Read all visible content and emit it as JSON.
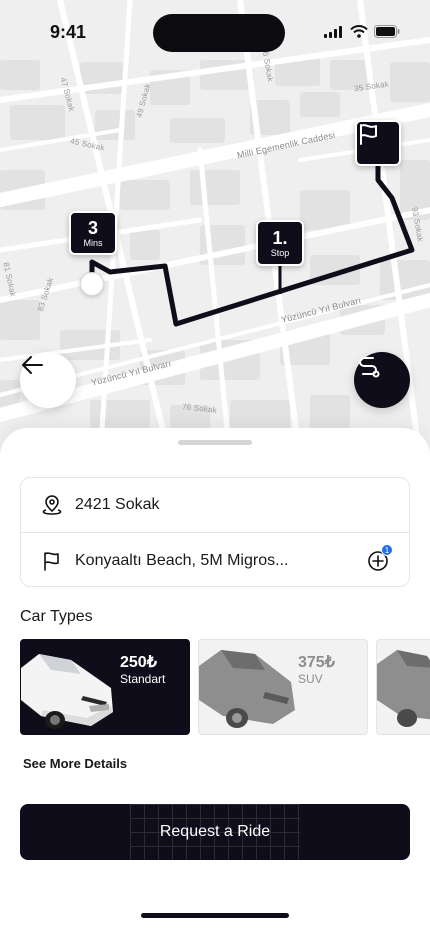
{
  "status_bar": {
    "time": "9:41"
  },
  "map": {
    "street_labels": [
      "Milli Egemenlik Caddesi",
      "Yüzüncü Yıl Bulvarı",
      "Yüzüncü Yıl Bulvarı",
      "76 Sokak",
      "49 Sokak",
      "47 Sokak",
      "45 Sokak",
      "35 Sokak",
      "56 Sokak",
      "81 Sokak",
      "83 Sokak",
      "93 Sokak"
    ],
    "markers": {
      "eta": {
        "number": "3",
        "unit": "Mins"
      },
      "stop": {
        "number": "1.",
        "label": "Stop"
      }
    }
  },
  "locations": {
    "pickup": "2421 Sokak",
    "destination": "Konyaaltı Beach, 5M Migros...",
    "stop_badge": "1"
  },
  "car_types": {
    "title": "Car Types",
    "items": [
      {
        "price": "250₺",
        "type": "Standart",
        "selected": true
      },
      {
        "price": "375₺",
        "type": "SUV",
        "selected": false
      }
    ]
  },
  "see_more": "See More Details",
  "request_button": "Request a Ride",
  "colors": {
    "primary": "#0f0d1a",
    "badge": "#1e6ee8",
    "map_bg": "#efefef"
  }
}
